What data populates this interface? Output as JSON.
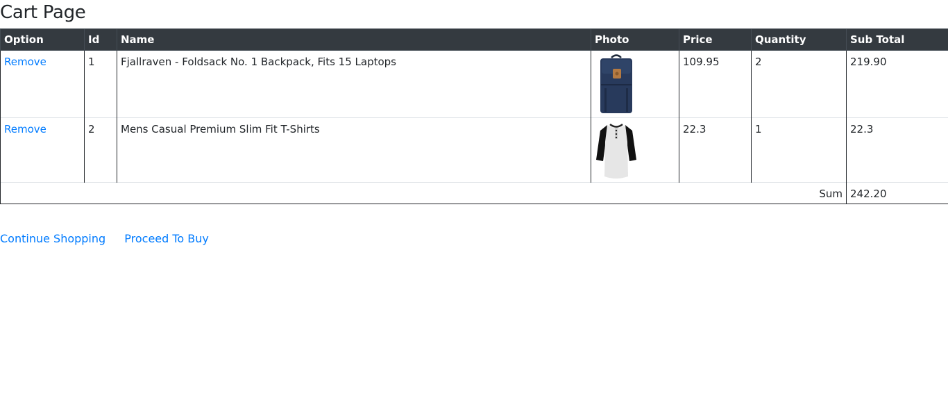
{
  "page": {
    "title": "Cart Page"
  },
  "table": {
    "headers": [
      "Option",
      "Id",
      "Name",
      "Photo",
      "Price",
      "Quantity",
      "Sub Total"
    ],
    "rows": [
      {
        "option": "Remove",
        "id": "1",
        "name": "Fjallraven - Foldsack No. 1 Backpack, Fits 15 Laptops",
        "photo": "backpack-photo",
        "price": "109.95",
        "quantity": "2",
        "subtotal": "219.90"
      },
      {
        "option": "Remove",
        "id": "2",
        "name": "Mens Casual Premium Slim Fit T-Shirts",
        "photo": "tshirt-photo",
        "price": "22.3",
        "quantity": "1",
        "subtotal": "22.3"
      }
    ],
    "sum_label": "Sum",
    "sum_value": "242.20"
  },
  "actions": {
    "continue_label": "Continue Shopping",
    "proceed_label": "Proceed To Buy"
  },
  "colors": {
    "header_bg": "#343a40",
    "link": "#007bff",
    "text": "#212529"
  }
}
